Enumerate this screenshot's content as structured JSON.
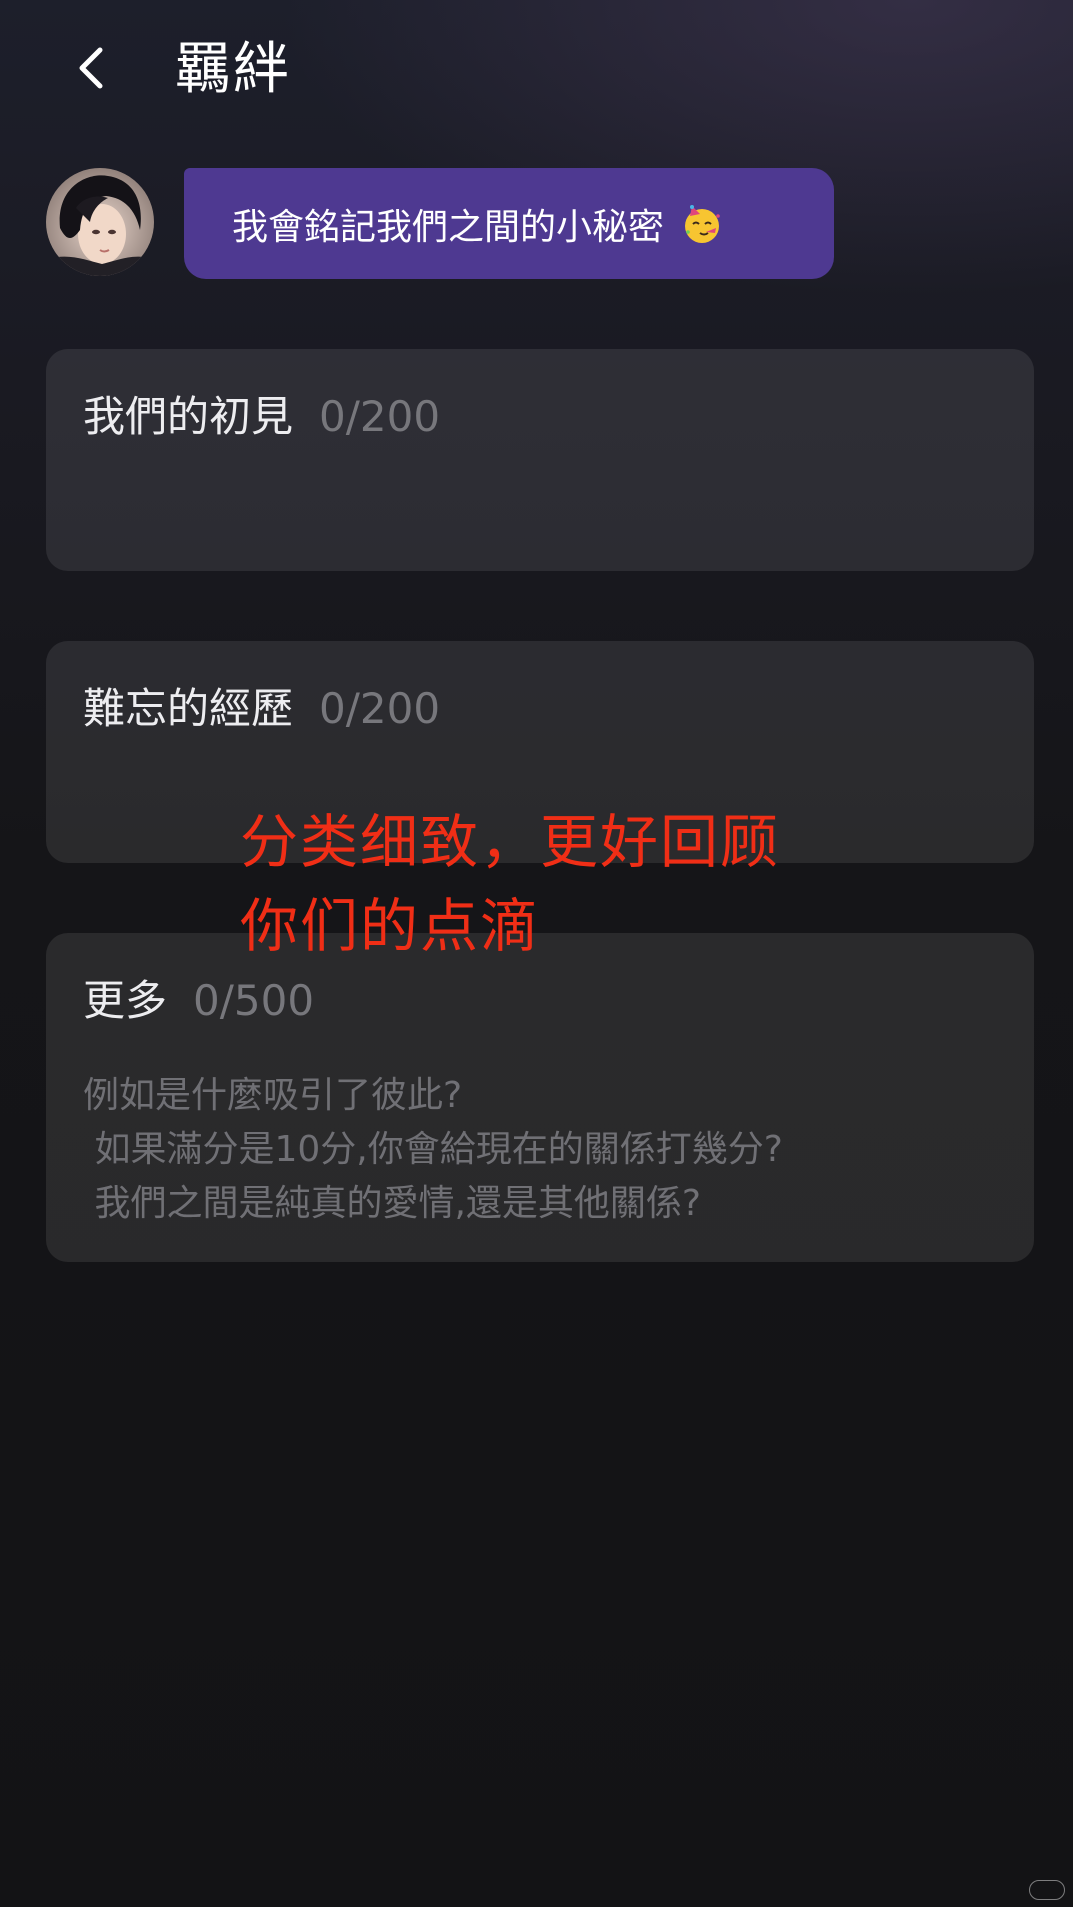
{
  "header": {
    "back_icon": "chevron-left-icon",
    "title": "羈絆"
  },
  "chat": {
    "avatar": "character-avatar",
    "message": "我會銘記我們之間的小秘密",
    "emoji": "partying-face"
  },
  "cards": [
    {
      "title": "我們的初見",
      "counter": "0/200",
      "placeholder": ""
    },
    {
      "title": "難忘的經歷",
      "counter": "0/200",
      "placeholder": ""
    },
    {
      "title": "更多",
      "counter": "0/500",
      "placeholder": "例如是什麼吸引了彼此?\n 如果滿分是10分,你會給現在的關係打幾分?\n 我們之間是純真的愛情,還是其他關係?"
    }
  ],
  "overlay": {
    "line1": "分类细致，更好回顾",
    "line2": "你们的点滴",
    "color": "#f02e16"
  },
  "colors": {
    "bubble": "#4e3991",
    "card": "rgba(255,255,255,0.09)",
    "background": "#131315"
  }
}
